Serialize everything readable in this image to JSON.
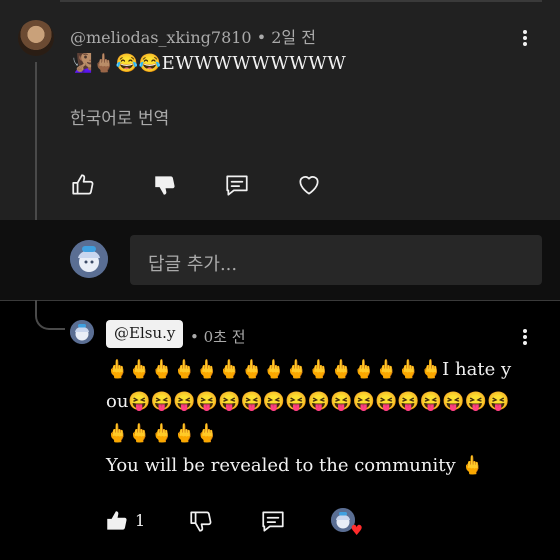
{
  "comment1": {
    "author": "@meliodas_xking7810",
    "time_label": "• 2일 전",
    "text": "🧏🏽‍♀️🖕🏽😂😂EWWWWWWWWW",
    "translate_label": "한국어로 번역"
  },
  "reply_input": {
    "placeholder": "답글 추가..."
  },
  "comment2": {
    "author": "@Elsu.y",
    "time_label": "• 0초 전",
    "text": "🖕🖕🖕🖕🖕🖕🖕🖕🖕🖕🖕🖕🖕🖕🖕I hate you😝😝😝😝😝😝😝😝😝😝😝😝😝😝😝😝😝🖕🖕🖕🖕🖕\nYou will be revealed to the community 🖕",
    "like_count": "1"
  },
  "icons": {
    "like": "thumbs-up-icon",
    "dislike": "thumbs-down-icon",
    "reply": "comment-icon",
    "hearted": "heart-icon",
    "more": "more-vertical-icon"
  },
  "colors": {
    "top_bg": "#212121",
    "page_bg": "#000000",
    "input_bg": "#272727",
    "heart": "#ff2b2b"
  }
}
